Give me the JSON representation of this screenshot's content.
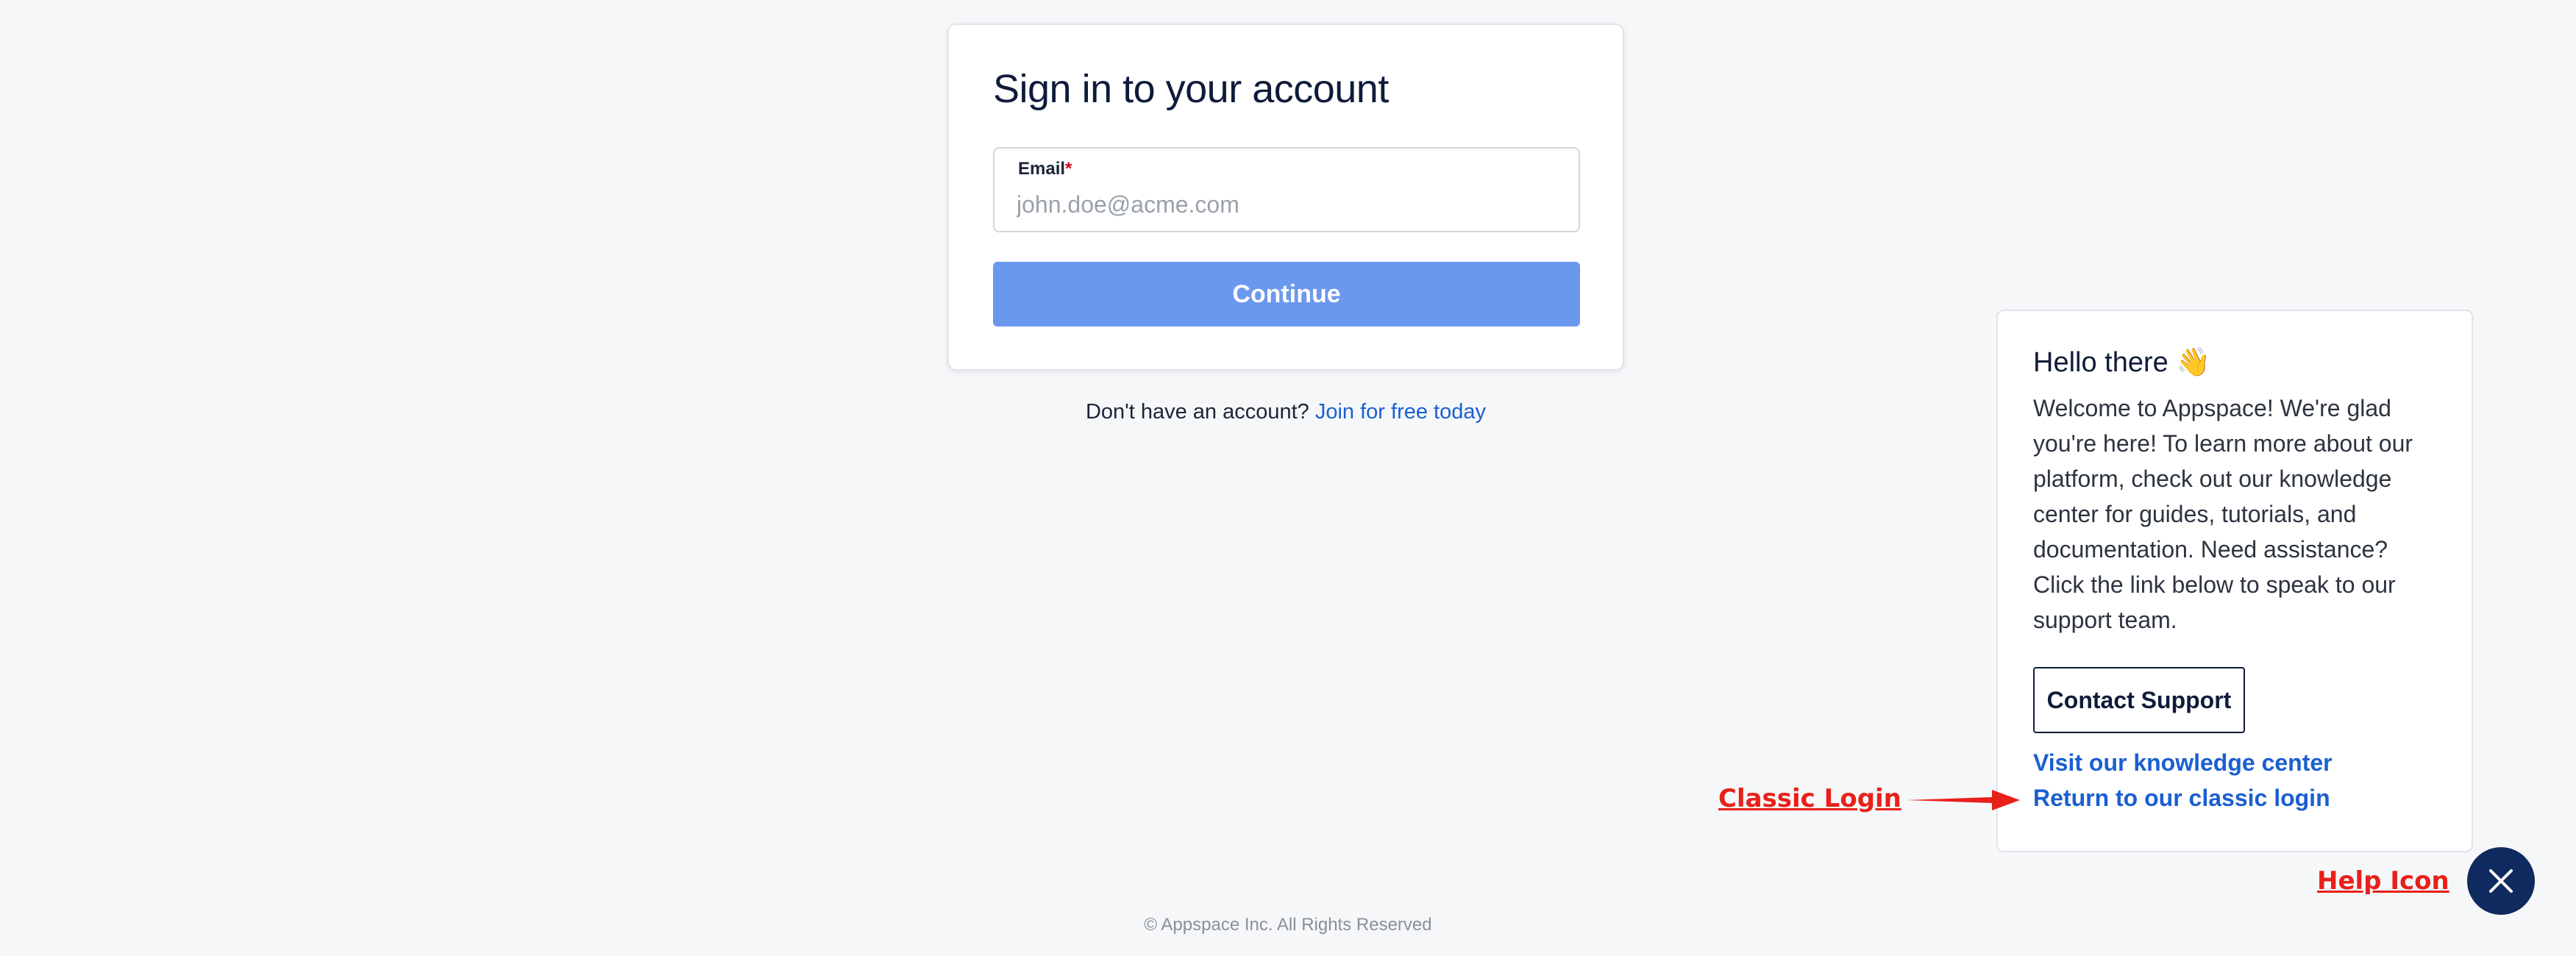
{
  "login": {
    "title": "Sign in to your account",
    "email_label": "Email",
    "required_mark": "*",
    "email_placeholder": "john.doe@acme.com",
    "email_value": "",
    "continue_label": "Continue",
    "signup_prompt": "Don't have an account?",
    "signup_link": "Join for free today"
  },
  "footer": {
    "copyright": "© Appspace Inc. All Rights Reserved"
  },
  "help_panel": {
    "greeting": "Hello there 👋",
    "message": "Welcome to Appspace! We're glad you're here! To learn more about our platform, check out our knowledge center for guides, tutorials, and documentation. Need assistance? Click the link below to speak to our support team.",
    "contact_button": "Contact Support",
    "knowledge_link": "Visit our knowledge center",
    "classic_link": "Return to our classic login",
    "close_icon": "close-icon"
  },
  "annotations": {
    "classic_login": "Classic Login",
    "help_icon": "Help Icon",
    "color": "#e8201a"
  },
  "colors": {
    "accent_button": "#6b98ef",
    "link": "#1a5fd1",
    "navy": "#0f1b3a",
    "fab": "#0f2a5e",
    "background": "#f6f7f9"
  }
}
